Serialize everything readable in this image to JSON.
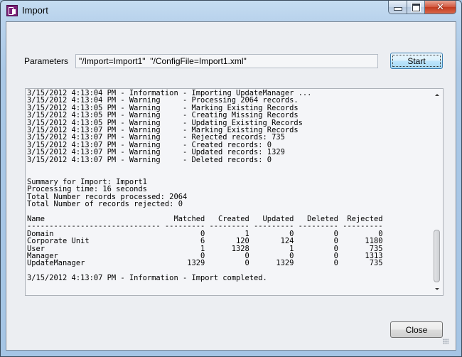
{
  "window": {
    "title": "Import",
    "app_icon": "import-app-icon",
    "caption_buttons": {
      "minimize_icon": "minimize-icon",
      "maximize_icon": "maximize-icon",
      "close_icon": "close-icon",
      "close_glyph": "✕"
    }
  },
  "parameters": {
    "label": "Parameters",
    "value": "\"/Import=Import1\"  \"/ConfigFile=Import1.xml\""
  },
  "buttons": {
    "start": "Start",
    "close": "Close"
  },
  "log": {
    "entries": [
      {
        "timestamp": "3/15/2012 4:13:04 PM",
        "level": "Information",
        "message": "Importing UpdateManager ..."
      },
      {
        "timestamp": "3/15/2012 4:13:04 PM",
        "level": "Warning",
        "message": "Processing 2064 records."
      },
      {
        "timestamp": "3/15/2012 4:13:05 PM",
        "level": "Warning",
        "message": "Marking Existing Records"
      },
      {
        "timestamp": "3/15/2012 4:13:05 PM",
        "level": "Warning",
        "message": "Creating Missing Records"
      },
      {
        "timestamp": "3/15/2012 4:13:05 PM",
        "level": "Warning",
        "message": "Updating Existing Records"
      },
      {
        "timestamp": "3/15/2012 4:13:07 PM",
        "level": "Warning",
        "message": "Marking Existing Records"
      },
      {
        "timestamp": "3/15/2012 4:13:07 PM",
        "level": "Warning",
        "message": "Rejected records: 735"
      },
      {
        "timestamp": "3/15/2012 4:13:07 PM",
        "level": "Warning",
        "message": "Created records: 0"
      },
      {
        "timestamp": "3/15/2012 4:13:07 PM",
        "level": "Warning",
        "message": "Updated records: 1329"
      },
      {
        "timestamp": "3/15/2012 4:13:07 PM",
        "level": "Warning",
        "message": "Deleted records: 0"
      }
    ],
    "summary": [
      "Summary for Import: Import1",
      "Processing time: 16 seconds",
      "Total Number records processed: 2064",
      "Total Number of records rejected: 0"
    ],
    "table": {
      "columns": [
        "Name",
        "Matched",
        "Created",
        "Updated",
        "Deleted",
        "Rejected"
      ],
      "rows": [
        [
          "Domain",
          "0",
          "1",
          "0",
          "0",
          "0"
        ],
        [
          "Corporate Unit",
          "6",
          "120",
          "124",
          "0",
          "1180"
        ],
        [
          "User",
          "1",
          "1328",
          "1",
          "0",
          "735"
        ],
        [
          "Manager",
          "0",
          "0",
          "0",
          "0",
          "1313"
        ],
        [
          "UpdateManager",
          "1329",
          "0",
          "1329",
          "0",
          "735"
        ]
      ]
    },
    "final_entry": {
      "timestamp": "3/15/2012 4:13:07 PM",
      "level": "Information",
      "message": "Import completed."
    }
  }
}
